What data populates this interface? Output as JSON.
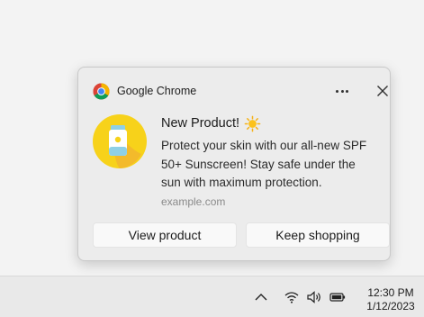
{
  "notification": {
    "app_name": "Google Chrome",
    "title": "New Product!",
    "body": "Protect your skin with our all-new SPF 50+ Sunscreen! Stay safe under the sun with maximum protection.",
    "attribution": "example.com",
    "actions": [
      {
        "label": "View product"
      },
      {
        "label": "Keep shopping"
      }
    ],
    "icons": {
      "app": "chrome-icon",
      "title_emoji": "sun-icon",
      "hero": "sunscreen-image",
      "more": "more-options-icon",
      "close": "close-icon"
    }
  },
  "taskbar": {
    "time": "12:30 PM",
    "date": "1/12/2023",
    "icons": [
      "chevron-up-icon",
      "wifi-icon",
      "volume-icon",
      "battery-icon"
    ]
  },
  "colors": {
    "toast_bg": "#ececec",
    "button_bg": "#f9f9f9",
    "hero_yellow": "#f7d21a",
    "taskbar_bg": "#e9e9e9"
  }
}
